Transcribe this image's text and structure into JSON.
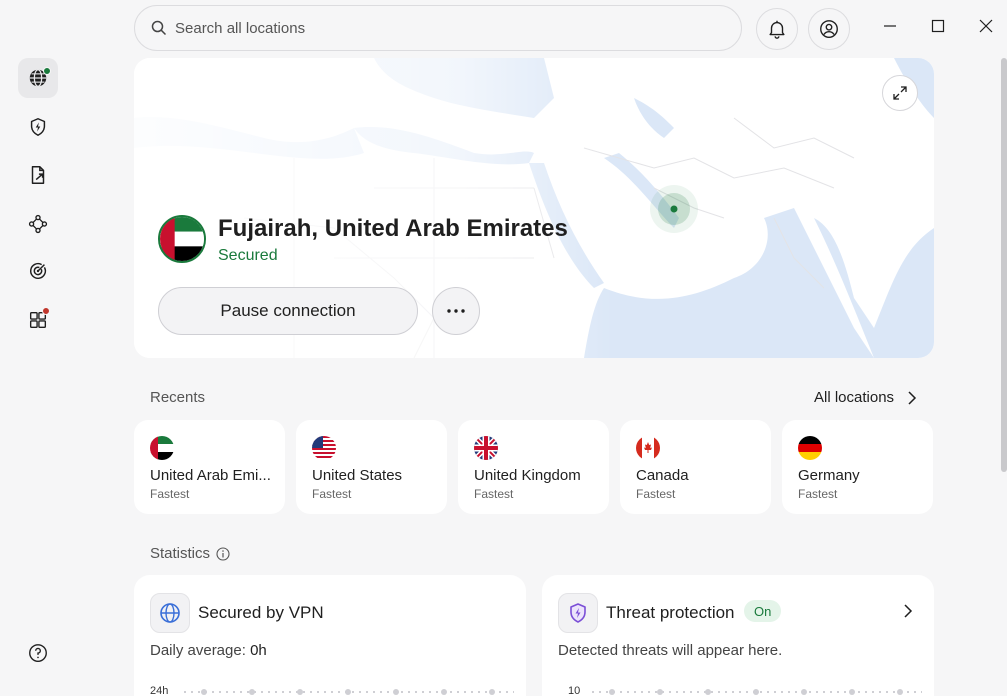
{
  "search": {
    "placeholder": "Search all locations"
  },
  "sidebar": {
    "items": [
      {
        "icon": "globe-icon",
        "active": true,
        "badge_color": "#1a7a3c"
      },
      {
        "icon": "shield-bolt-icon"
      },
      {
        "icon": "file-share-icon"
      },
      {
        "icon": "meshnet-icon"
      },
      {
        "icon": "radar-icon"
      },
      {
        "icon": "apps-icon",
        "badge_color": "#c0362c"
      }
    ],
    "help_icon": "help-icon"
  },
  "header": {
    "notifications_icon": "bell-icon",
    "profile_icon": "user-icon"
  },
  "connection": {
    "location": "Fujairah, United Arab Emirates",
    "status": "Secured",
    "pause_label": "Pause connection",
    "more_icon": "more-icon"
  },
  "recents": {
    "label": "Recents",
    "all_locations_label": "All locations",
    "items": [
      {
        "name": "United Arab Emi...",
        "sub": "Fastest",
        "flag": "uae"
      },
      {
        "name": "United States",
        "sub": "Fastest",
        "flag": "us"
      },
      {
        "name": "United Kingdom",
        "sub": "Fastest",
        "flag": "uk"
      },
      {
        "name": "Canada",
        "sub": "Fastest",
        "flag": "ca"
      },
      {
        "name": "Germany",
        "sub": "Fastest",
        "flag": "de"
      }
    ]
  },
  "statistics": {
    "label": "Statistics",
    "vpn": {
      "title": "Secured by VPN",
      "daily_prefix": "Daily average: ",
      "daily_value": "0h",
      "axis_top": "24h"
    },
    "threat": {
      "title": "Threat protection",
      "badge": "On",
      "sub": "Detected threats will appear here.",
      "axis_top": "10"
    }
  },
  "colors": {
    "accent_green": "#1a7a3c",
    "alert_red": "#c0362c",
    "map_water": "#dbe7f7"
  }
}
